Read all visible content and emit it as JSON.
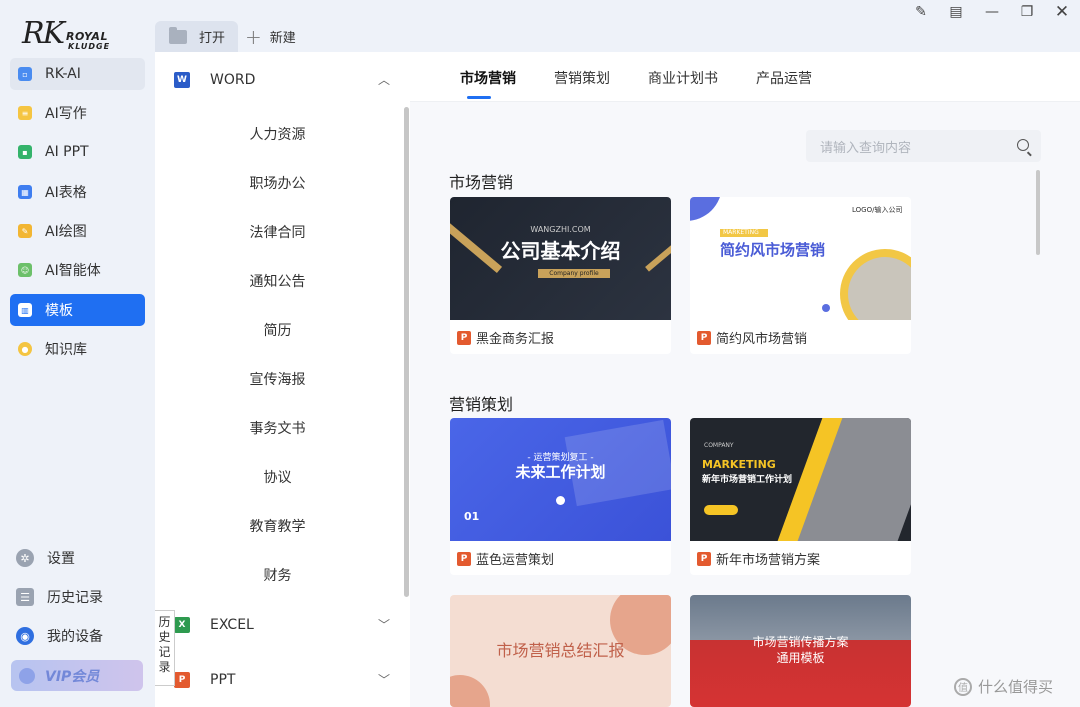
{
  "logo": {
    "mark": "RK",
    "line1": "ROYAL",
    "line2": "KLUDGE"
  },
  "sidebar": {
    "items": [
      {
        "label": "RK-AI",
        "icon": "rk-ai-icon",
        "color": "#4a8cf0"
      },
      {
        "label": "AI写作",
        "icon": "ai-writing-icon",
        "color": "#f5c542"
      },
      {
        "label": "AI PPT",
        "icon": "ai-ppt-icon",
        "color": "#34b36b"
      },
      {
        "label": "AI表格",
        "icon": "ai-sheet-icon",
        "color": "#3f7ef0"
      },
      {
        "label": "AI绘图",
        "icon": "ai-draw-icon",
        "color": "#f2b633"
      },
      {
        "label": "AI智能体",
        "icon": "ai-agent-icon",
        "color": "#6cc06a"
      },
      {
        "label": "模板",
        "icon": "template-icon",
        "color": "#ffffff"
      },
      {
        "label": "知识库",
        "icon": "knowledge-icon",
        "color": "#f4c542"
      }
    ],
    "bottom": [
      {
        "label": "设置",
        "icon": "gear-icon"
      },
      {
        "label": "历史记录",
        "icon": "history-icon"
      },
      {
        "label": "我的设备",
        "icon": "device-icon"
      }
    ],
    "vip_label": "VIP会员"
  },
  "toolbar": {
    "open_label": "打开",
    "new_label": "新建"
  },
  "categories": {
    "word": {
      "label": "WORD",
      "badge": "W",
      "chevron": "︿"
    },
    "word_items": [
      "人力资源",
      "职场办公",
      "法律合同",
      "通知公告",
      "简历",
      "宣传海报",
      "事务文书",
      "协议",
      "教育教学",
      "财务"
    ],
    "excel": {
      "label": "EXCEL",
      "badge": "X",
      "chevron": "﹀"
    },
    "ppt": {
      "label": "PPT",
      "badge": "P",
      "chevron": "﹀"
    },
    "history_vertical": [
      "历",
      "史",
      "记",
      "录"
    ]
  },
  "content_tabs": [
    "市场营销",
    "营销策划",
    "商业计划书",
    "产品运营"
  ],
  "search": {
    "placeholder": "请输入查询内容"
  },
  "sections": [
    {
      "title": "市场营销",
      "cards": [
        {
          "name": "黑金商务汇报",
          "thumb_text": "公司基本介绍",
          "thumb_sub": "Company profile",
          "thumb_top": "WANGZHI.COM"
        },
        {
          "name": "简约风市场营销",
          "thumb_text": "简约风市场营销",
          "thumb_sub": "MARKETING",
          "thumb_top": "LOGO/输入公司"
        }
      ]
    },
    {
      "title": "营销策划",
      "cards": [
        {
          "name": "蓝色运营策划",
          "thumb_text": "未来工作计划",
          "thumb_sub": "- 运营策划复工 -",
          "thumb_top": "01"
        },
        {
          "name": "新年市场营销方案",
          "thumb_text": "新年市场营销工作计划",
          "thumb_sub": "MARKETING",
          "thumb_top": "COMPANY"
        }
      ]
    },
    {
      "title": "",
      "cards": [
        {
          "name": "",
          "thumb_text": "市场营销总结汇报",
          "thumb_sub": "",
          "thumb_top": ""
        },
        {
          "name": "",
          "thumb_text": "市场营销传播方案",
          "thumb_sub": "通用模板",
          "thumb_top": ""
        }
      ]
    }
  ],
  "ppt_badge": "P",
  "watermark": "什么值得买"
}
